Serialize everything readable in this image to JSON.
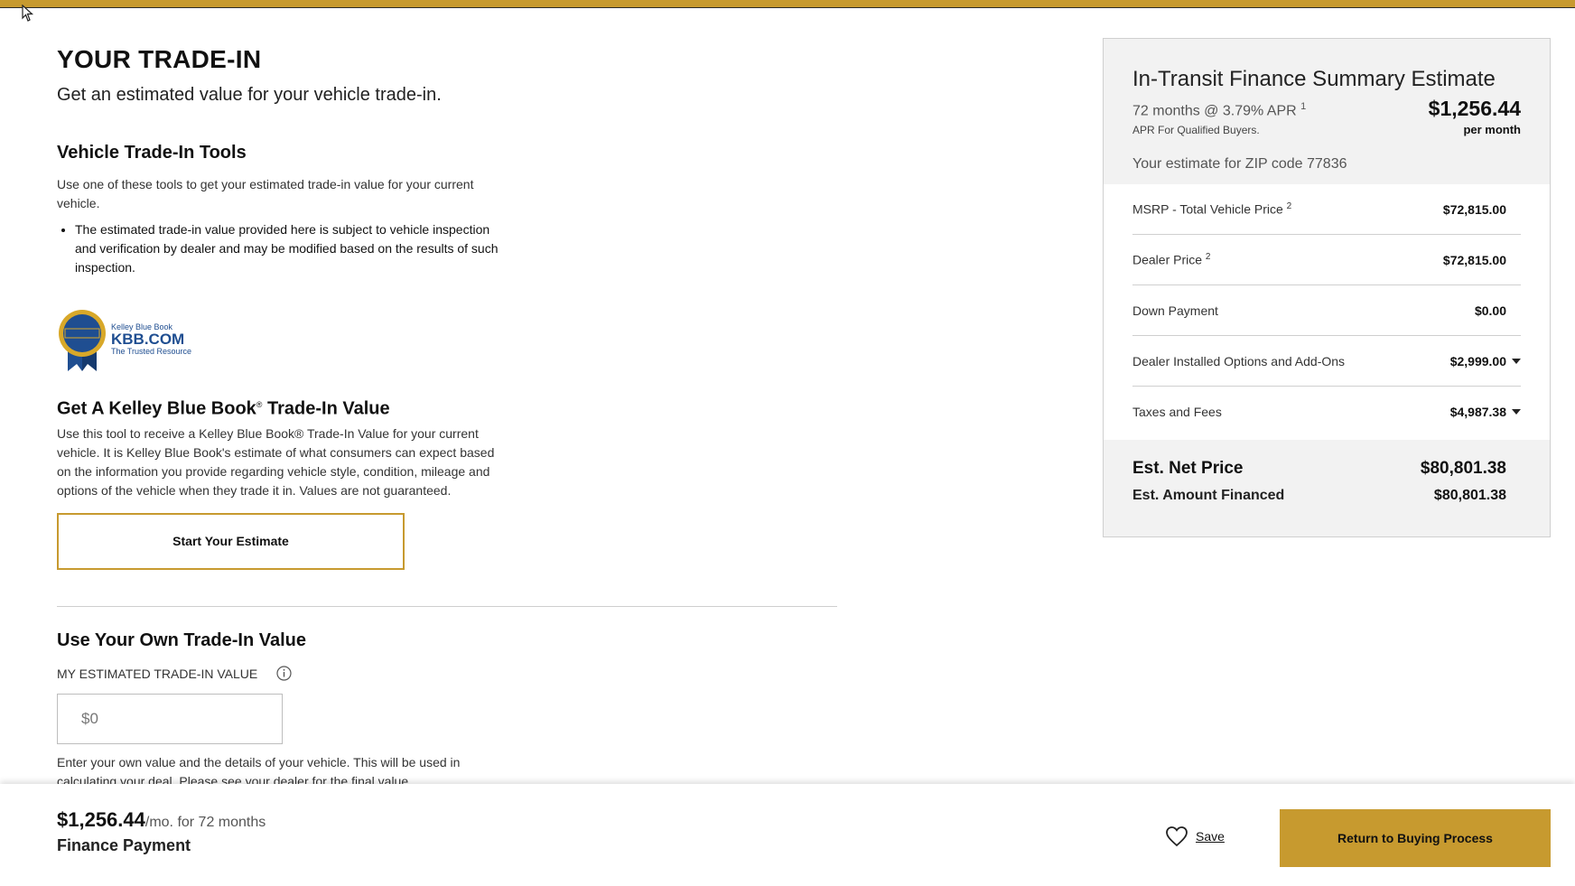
{
  "colors": {
    "accent": "#c79a2f",
    "panel_bg": "#f2f2f2",
    "divider": "#cfcfcf"
  },
  "main": {
    "title": "YOUR TRADE-IN",
    "subtitle": "Get an estimated value for your vehicle trade-in.",
    "tools": {
      "title": "Vehicle Trade-In Tools",
      "description": "Use one of these tools to get your estimated trade-in value for your current vehicle.",
      "bullets": [
        "The estimated trade-in value provided here is subject to vehicle inspection and verification by dealer and may be modified based on the results of such inspection."
      ]
    },
    "kbb": {
      "logo_small": "Kelley Blue Book",
      "logo_big": "KBB.COM",
      "logo_tagline": "The Trusted Resource",
      "badge_text": "KELLEY BLUE BOOK",
      "title_main": "Get A Kelley Blue Book",
      "title_reg": "®",
      "title_end": " Trade-In Value",
      "description": "Use this tool to receive a Kelley Blue Book® Trade-In Value for your current vehicle. It is Kelley Blue Book's estimate of what consumers can expect based on the information you provide regarding vehicle style, condition, mileage and options of the vehicle when they trade it in. Values are not guaranteed.",
      "button_label": "Start Your Estimate"
    },
    "own_value": {
      "title": "Use Your Own Trade-In Value",
      "label": "MY ESTIMATED TRADE-IN VALUE",
      "input_placeholder": "$0",
      "note": "Enter your own value and the details of your vehicle. This will be used in calculating your deal. Please see your dealer for the final value."
    }
  },
  "summary": {
    "title": "In-Transit Finance Summary Estimate",
    "apr_text": "72 months @ 3.79% APR",
    "apr_footnote": "1",
    "monthly": "$1,256.44",
    "per_month": "per month",
    "qualified": "APR For Qualified Buyers.",
    "zip_text": "Your estimate for ZIP code 77836",
    "lines": [
      {
        "label": "MSRP - Total Vehicle Price",
        "footnote": "2",
        "value": "$72,815.00"
      },
      {
        "label": "Dealer Price",
        "footnote": "2",
        "value": "$72,815.00"
      },
      {
        "label": "Down Payment",
        "footnote": "",
        "value": "$0.00"
      },
      {
        "label": "Dealer Installed Options and Add-Ons",
        "footnote": "",
        "value": "$2,999.00"
      },
      {
        "label": "Taxes and Fees",
        "footnote": "",
        "value": "$4,987.38"
      }
    ],
    "net_label": "Est. Net Price",
    "net_value": "$80,801.38",
    "financed_label": "Est. Amount Financed",
    "financed_value": "$80,801.38"
  },
  "bottom_bar": {
    "price": "$1,256.44",
    "price_suffix": "/mo. for 72 months",
    "label": "Finance Payment",
    "save_label": "Save",
    "return_label": "Return to Buying Process"
  }
}
